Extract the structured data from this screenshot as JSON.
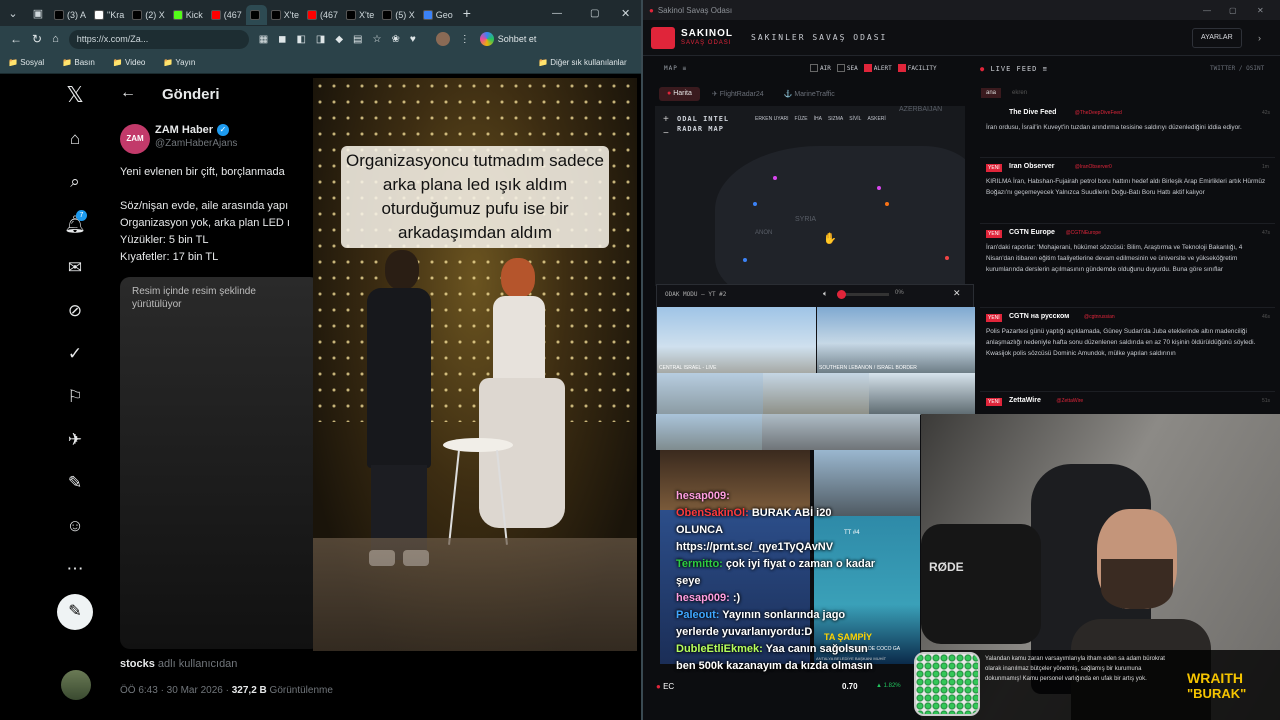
{
  "browser": {
    "tabs": [
      {
        "label": "(3) A",
        "icon": "x-icon"
      },
      {
        "label": "\"Kra",
        "icon": "news-icon"
      },
      {
        "label": "(2) X",
        "icon": "x-icon"
      },
      {
        "label": "Kick",
        "icon": "kick-icon"
      },
      {
        "label": "(467",
        "icon": "youtube-icon"
      },
      {
        "label": "",
        "icon": "x-icon"
      },
      {
        "label": "X'te",
        "icon": "x-icon"
      },
      {
        "label": "(467",
        "icon": "youtube-icon"
      },
      {
        "label": "X'te",
        "icon": "x-icon"
      },
      {
        "label": "(5) X",
        "icon": "x-icon"
      },
      {
        "label": "Geo",
        "icon": "globe-icon"
      }
    ],
    "url": "https://x.com/Za...",
    "copilot_label": "Sohbet et",
    "bookmarks": [
      "Sosyal",
      "Basın",
      "Video",
      "Yayın"
    ],
    "other_bookmarks": "Diğer sık kullanılanlar"
  },
  "x": {
    "page_title": "Gönderi",
    "author_name": "ZAM Haber",
    "author_handle": "@ZamHaberAjans",
    "avatar_text": "ZAM",
    "notif_count": "7",
    "post_lines": [
      "Yeni evlenen bir çift, borçlanmada",
      "",
      "Söz/nişan evde, aile arasında yapı",
      "Organizasyon yok, arka plan LED ı",
      "Yüzükler: 5 bin TL",
      "Kıyafetler: 17 bin TL"
    ],
    "pip_text": "Resim içinde resim şeklinde yürütülüyor",
    "video_caption": "Organizasyoncu tutmadım sadece arka plana led ışık aldım oturduğumuz pufu ise bir arkadaşımdan aldım",
    "source_user": "stocks",
    "source_suffix": "adlı kullanıcıdan",
    "timestamp": "ÖÖ 6:43 · 30 Mar 2026 ·",
    "views": "327,2 B",
    "views_label": "Görüntülenme"
  },
  "app": {
    "window_title": "Sakinol Savaş Odası",
    "logo_title": "SAKINOL",
    "logo_sub": "SAVAŞ ODASI",
    "header_title": "SAKINLER SAVAŞ ODASI",
    "settings_label": "AYARLAR",
    "map_label": "MAP",
    "filters": [
      {
        "label": "AIR",
        "checked": false
      },
      {
        "label": "SEA",
        "checked": false
      },
      {
        "label": "ALERT",
        "checked": true
      },
      {
        "label": "FACILITY",
        "checked": true
      }
    ],
    "map_tabs": [
      "Harita",
      "FlightRadar24",
      "MarineTraffic"
    ],
    "map_overlay_title": "ODAL INTEL RADAR MAP",
    "map_legend": [
      "ERKEN UYARI",
      "FÜZE",
      "İHA",
      "SIZMA",
      "SİVİL",
      "ASKERİ"
    ],
    "map_label_syria": "SYRIA",
    "map_label_azerbaijan": "AZERBAIJAN",
    "map_label_lebanon": "ANON",
    "live_feed_label": "LIVE FEED",
    "live_feed_sources": "TWITTER / OSINT",
    "feed_tabs": [
      "ana",
      "ekren"
    ],
    "feed": [
      {
        "badge": "",
        "name": "The Dive Feed",
        "handle": "@TheDeepDiveFeed",
        "time": "42s",
        "text": "İran ordusu, İsrail'in Kuveyt'in tuzdan arındırma tesisine saldırıyı düzenlediğini iddia ediyor."
      },
      {
        "badge": "YENİ",
        "name": "Iran Observer",
        "handle": "@IranObserver0",
        "time": "1m",
        "text": "KIRILMA İran, Habshan-Fujairah petrol boru hattını hedef aldı Birleşik Arap Emirlikleri artık Hürmüz Boğazı'nı geçemeyecek Yalnızca Suudilerin Doğu-Batı Boru Hattı aktif kalıyor"
      },
      {
        "badge": "YENİ",
        "name": "CGTN Europe",
        "handle": "@CGTNEurope",
        "time": "47s",
        "text": "İran'daki raporlar: 'Mohajerani, hükümet sözcüsü: Bilim, Araştırma ve Teknoloji Bakanlığı, 4 Nisan'dan itibaren eğitim faaliyetlerine devam edilmesinin ve üniversite ve yükseköğretim kurumlarında derslerin açılmasının gündemde olduğunu duyurdu. Buna göre sınıflar"
      },
      {
        "badge": "YENİ",
        "name": "CGTN на русском",
        "handle": "@cgtnrussian",
        "time": "46s",
        "text": "Polis Pazartesi günü yaptığı açıklamada, Güney Sudan'da Juba eteklerinde altın madenciliği anlaşmazlığı nedeniyle hafta sonu düzenlenen saldırıda en az 70 kişinin öldürüldüğünü söyledi. Kwasijok polis sözcüsü Dominic Amundok, mülke yapılan saldırının"
      },
      {
        "badge": "YENİ",
        "name": "ZettaWire",
        "handle": "@ZettaWire",
        "time": "51s",
        "text": ""
      }
    ],
    "odak_label": "ODAK MODU — YT #2",
    "odak_volume": "0%",
    "cam_labels": [
      "CENTRAL ISRAEL - LIVE",
      "SOUTHERN LEBANON / ISRAEL BORDER",
      "TT #4"
    ],
    "ticker_label": "EC",
    "ticker_value": "0.70",
    "ticker_change": "▲ 1.82%",
    "tennis_banner": "TA ŞAMPİY",
    "tennis_sub": "1 NUMARASI FINALDE COCO GA",
    "tennis_foot": "ANTALYA BELEDİYE BAŞKANI MUHİT",
    "bottom_news": "Yalandan kamu zararı varsayımlarıyla itham eden sa adam bürokrat olarak inanılmaz bütçeler yönetmiş, sağlamış bir kurumuna dokunmamış! Kamu personel varlığında en ufak bir artış yok.",
    "overlay_brand_1": "WRAITH",
    "overlay_brand_2": "\"BURAK\"",
    "mic_brand": "RØDE"
  },
  "chat": [
    {
      "user": "hesap009:",
      "msg": "",
      "user_color": "#ff9ee0"
    },
    {
      "user": "ObenSakinOl:",
      "msg": "BURAK ABİ i20 OLUNCA https://prnt.sc/_qye1TyQAvNV",
      "user_color": "#ff3b3b"
    },
    {
      "user": "Termitto:",
      "msg": "çok iyi fiyat o zaman o kadar şeye",
      "user_color": "#2ecc40"
    },
    {
      "user": "hesap009:",
      "msg": ":)",
      "user_color": "#ff9ee0"
    },
    {
      "user": "Paleout:",
      "msg": "Yayının sonlarında jago yerlerde yuvarlanıyordu:D",
      "user_color": "#3fa7ff"
    },
    {
      "user": "DubleEtliEkmek:",
      "msg": "Yaa canın sağolsun ben 500k kazanayım da kızda olmasın",
      "user_color": "#b6ff5c"
    }
  ],
  "colors": {
    "x_bg": "#000000",
    "x_accent": "#1d9bf0",
    "app_red": "#e0253a",
    "app_bg": "#0c0d10"
  }
}
